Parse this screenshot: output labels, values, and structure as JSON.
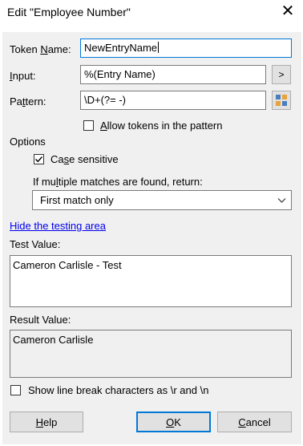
{
  "window": {
    "title": "Edit \"Employee Number\"",
    "close_glyph": "✕"
  },
  "token_name": {
    "label_pre": "Token ",
    "label_accel": "N",
    "label_post": "ame:",
    "value": "NewEntryName"
  },
  "input": {
    "label_pre": "",
    "label_accel": "I",
    "label_post": "nput:",
    "value": "%(Entry Name)",
    "button_label": ">"
  },
  "pattern": {
    "label_pre": "Pa",
    "label_accel": "t",
    "label_post": "tern:",
    "value": "\\D+(?= -)",
    "button_icon": "palette-icon"
  },
  "allow_tokens": {
    "checked": false,
    "label_pre": "",
    "label_accel": "A",
    "label_post": "llow tokens in the pattern"
  },
  "options": {
    "heading": "Options",
    "case_sensitive": {
      "checked": true,
      "label_pre": "Ca",
      "label_accel": "s",
      "label_post": "e sensitive"
    },
    "multiple_label": {
      "pre": "If mu",
      "accel": "l",
      "post": "tiple matches are found, return:"
    },
    "multiple_value": "First match only"
  },
  "testing_link": "Hide the testing area",
  "test_value": {
    "label": "Test Value:",
    "value": "Cameron Carlisle - Test"
  },
  "result_value": {
    "label": "Result Value:",
    "value": "Cameron Carlisle"
  },
  "show_line_breaks": {
    "checked": false,
    "label": "Show line break characters as \\r and \\n"
  },
  "buttons": {
    "help": {
      "accel": "H",
      "rest": "elp"
    },
    "ok": {
      "accel": "O",
      "rest": "K"
    },
    "cancel": {
      "accel": "C",
      "rest": "ancel"
    }
  },
  "colors": {
    "accent": "#0078d7",
    "link": "#0000ee",
    "panel": "#f0f0f0"
  }
}
